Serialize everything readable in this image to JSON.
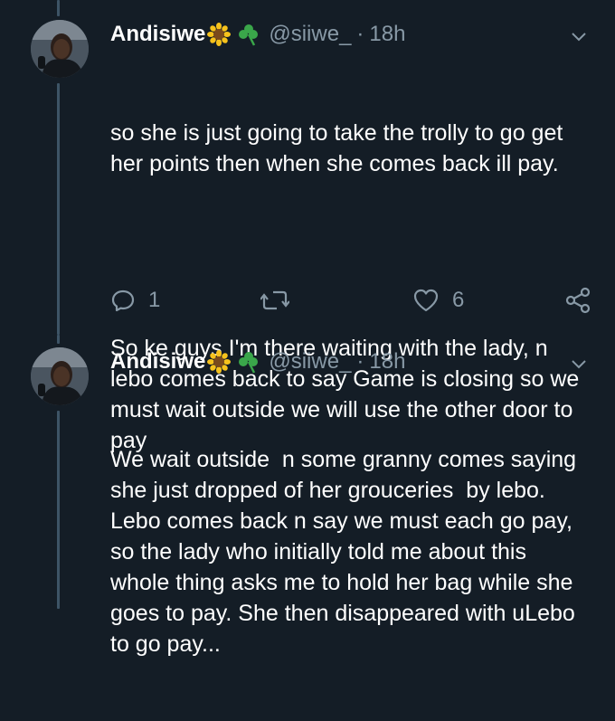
{
  "tweets": [
    {
      "author_name": "Andisiwe",
      "author_emoji": "🌻☘️",
      "handle": "@siiwe_",
      "time_separator": "·",
      "time": "18h",
      "paragraphs": [
        "so she is just going to take the trolly to go get her points then when she comes back ill pay.",
        "So ke guys I'm there waiting with the lady, n lebo comes back to say Game is closing so we must wait outside we will use the other door to pay"
      ],
      "reply_count": "1",
      "like_count": "6"
    },
    {
      "author_name": "Andisiwe",
      "author_emoji": "🌻☘️",
      "handle": "@siiwe_",
      "time_separator": "·",
      "time": "18h",
      "paragraphs": [
        "We wait outside  n some granny comes saying she just dropped of her grouceries  by lebo. Lebo comes back n say we must each go pay, so the lady who initially told me about this whole thing asks me to hold her bag while she goes to pay. She then disappeared with uLebo to go pay..."
      ]
    }
  ],
  "icons": {
    "reply": "comment-icon",
    "retweet": "retweet-icon",
    "like": "heart-icon",
    "share": "share-icon",
    "menu": "chevron-down-icon"
  },
  "colors": {
    "background": "#141d26",
    "text": "#ffffff",
    "secondary": "#8899a6",
    "thread_line": "#3d5466"
  }
}
